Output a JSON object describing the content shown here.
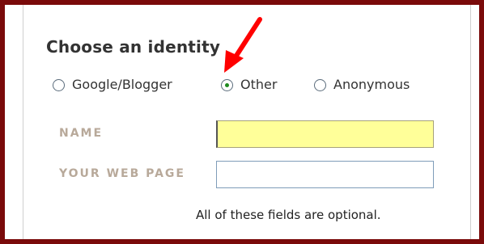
{
  "form": {
    "title": "Choose an identity",
    "identity_options": [
      {
        "label": "Google/Blogger",
        "selected": false
      },
      {
        "label": "Other",
        "selected": true
      },
      {
        "label": "Anonymous",
        "selected": false
      }
    ],
    "fields": {
      "name_label": "NAME",
      "name_value": "",
      "webpage_label": "YOUR WEB PAGE",
      "webpage_value": ""
    },
    "note": "All of these fields are optional."
  },
  "colors": {
    "frame_border": "#7a0a0a",
    "arrow": "#ff0000",
    "name_input_bg": "#ffff99",
    "label_text": "#b8a99a"
  }
}
